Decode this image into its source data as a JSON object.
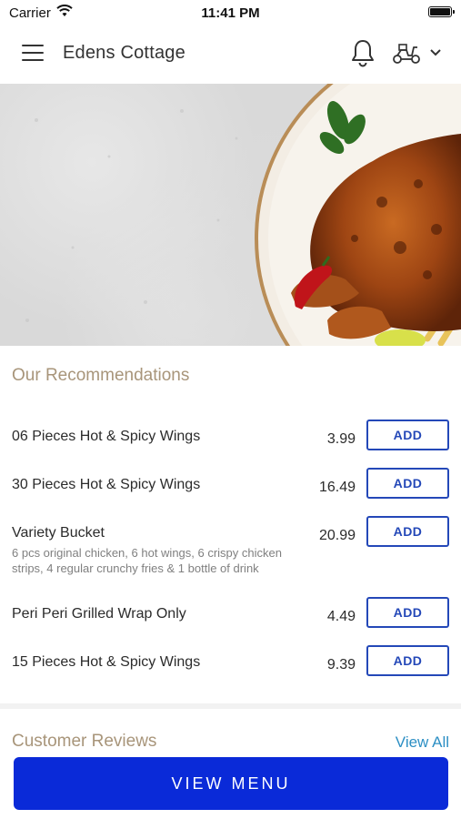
{
  "status_bar": {
    "carrier": "Carrier",
    "time": "11:41 PM"
  },
  "header": {
    "title": "Edens Cottage"
  },
  "recommendations": {
    "title": "Our Recommendations",
    "items": [
      {
        "name": "06 Pieces Hot & Spicy Wings",
        "desc": "",
        "price": "3.99",
        "button": "ADD"
      },
      {
        "name": "30 Pieces Hot & Spicy Wings",
        "desc": "",
        "price": "16.49",
        "button": "ADD"
      },
      {
        "name": "Variety Bucket",
        "desc": "6 pcs original chicken, 6 hot wings, 6 crispy chicken strips, 4 regular crunchy fries & 1 bottle of drink",
        "price": "20.99",
        "button": "ADD"
      },
      {
        "name": "Peri Peri Grilled Wrap Only",
        "desc": "",
        "price": "4.49",
        "button": "ADD"
      },
      {
        "name": "15 Pieces Hot & Spicy Wings",
        "desc": "",
        "price": "9.39",
        "button": "ADD"
      }
    ]
  },
  "reviews": {
    "title": "Customer Reviews",
    "view_all": "View All"
  },
  "footer": {
    "view_menu": "VIEW MENU"
  },
  "icons": {
    "menu": "hamburger-menu-icon",
    "notifications": "bell-icon",
    "delivery": "scooter-icon",
    "dropdown": "chevron-down-icon"
  },
  "colors": {
    "accent_blue": "#0a2ad8",
    "button_outline": "#2448b8",
    "section_title": "#a8957a",
    "link": "#2d8fc4"
  }
}
